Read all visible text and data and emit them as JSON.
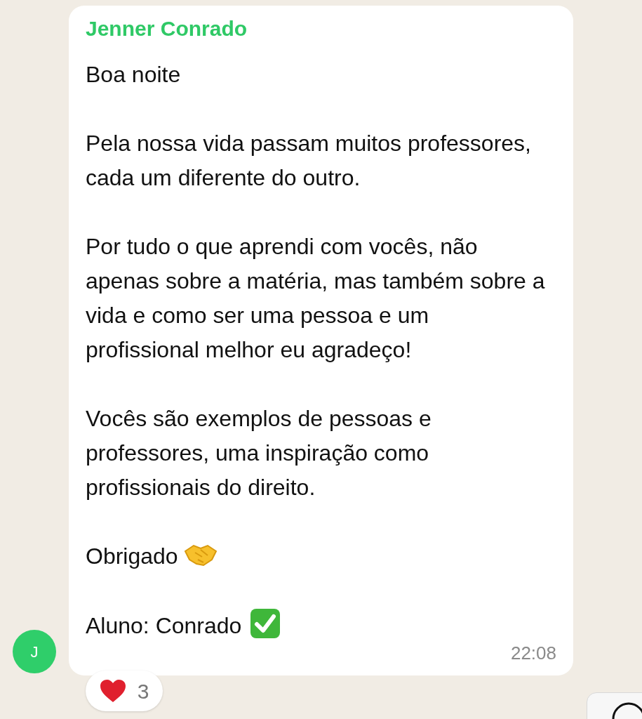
{
  "message": {
    "sender": "Jenner Conrado",
    "paragraphs": [
      {
        "text": "Boa noite"
      },
      {
        "text": "Pela nossa vida passam muitos professores, cada um diferente do outro."
      },
      {
        "text": "Por tudo o que aprendi com vocês, não apenas sobre a matéria, mas também sobre a vida e como ser uma pessoa e um profissional melhor eu agradeço!"
      },
      {
        "text": "Vocês são exemplos de pessoas e professores, uma inspiração como profissionais do direito."
      },
      {
        "text": "Obrigado",
        "kind": "handshake"
      },
      {
        "text": "Aluno: Conrado",
        "kind": "check"
      }
    ],
    "time": "22:08",
    "avatar": "J",
    "reaction": {
      "kind": "heart",
      "count": "3"
    }
  }
}
